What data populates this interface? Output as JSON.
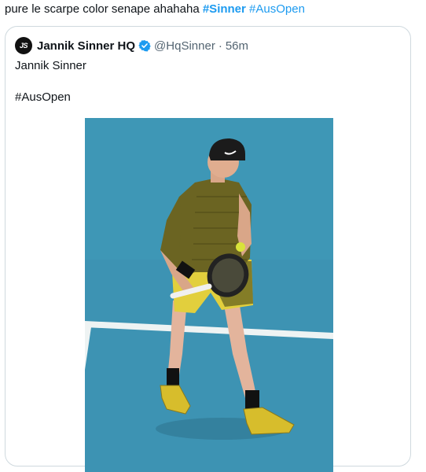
{
  "tweet": {
    "text": "pure le scarpe color senape ahahaha ",
    "hashtag1": "#Sinner",
    "hashtag2": "#AusOpen"
  },
  "quote": {
    "avatar_text": "JS",
    "display_name": "Jannik Sinner HQ",
    "handle": "@HqSinner",
    "separator": "·",
    "time": "56m",
    "line1": "Jannik Sinner",
    "line2": "#AusOpen"
  },
  "colors": {
    "link": "#1d9bf0",
    "court": "#3d93b3",
    "verified": "#1d9bf0"
  },
  "icons": {
    "verified": "verified-badge-icon"
  }
}
